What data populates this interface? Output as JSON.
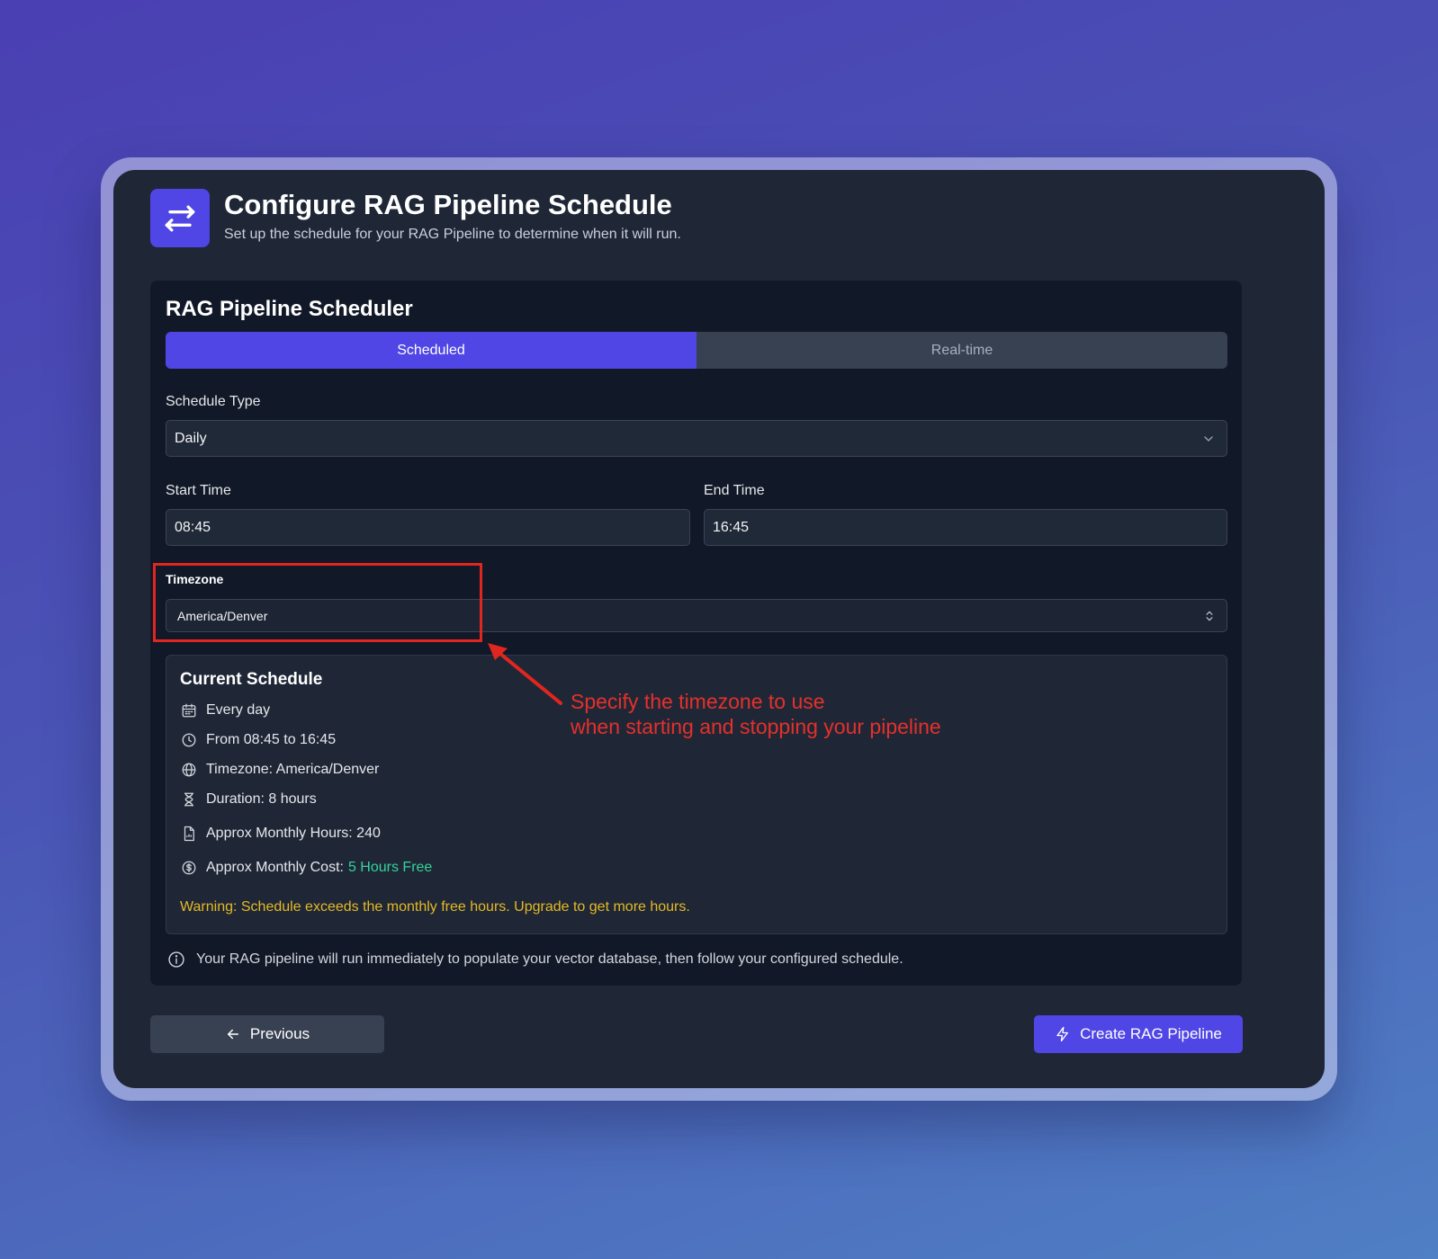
{
  "header": {
    "title": "Configure RAG Pipeline Schedule",
    "subtitle": "Set up the schedule for your RAG Pipeline to determine when it will run.",
    "icon": "arrows-swap-icon"
  },
  "scheduler": {
    "title": "RAG Pipeline Scheduler",
    "tabs": [
      {
        "label": "Scheduled",
        "active": true
      },
      {
        "label": "Real-time",
        "active": false
      }
    ],
    "schedule_type": {
      "label": "Schedule Type",
      "value": "Daily"
    },
    "start_time": {
      "label": "Start Time",
      "value": "08:45"
    },
    "end_time": {
      "label": "End Time",
      "value": "16:45"
    },
    "timezone": {
      "label": "Timezone",
      "value": "America/Denver"
    }
  },
  "annotation": {
    "line1": "Specify the timezone to use",
    "line2": "when starting and stopping your pipeline",
    "color": "#e5302a"
  },
  "current_schedule": {
    "title": "Current Schedule",
    "frequency": "Every day",
    "time_range": "From 08:45 to 16:45",
    "timezone": "Timezone: America/Denver",
    "duration": "Duration: 8 hours",
    "monthly_hours": "Approx Monthly Hours: 240",
    "monthly_cost_label": "Approx Monthly Cost:",
    "monthly_cost_value": "5 Hours Free",
    "warning": "Warning: Schedule exceeds the monthly free hours. Upgrade to get more hours."
  },
  "info_note": "Your RAG pipeline will run immediately to populate your vector database, then follow your configured schedule.",
  "footer": {
    "previous_label": "Previous",
    "create_label": "Create RAG Pipeline"
  },
  "colors": {
    "accent": "#4f46e5",
    "panel": "#111827",
    "window": "#1f2737",
    "success": "#34d399",
    "warning": "#e5b923"
  }
}
